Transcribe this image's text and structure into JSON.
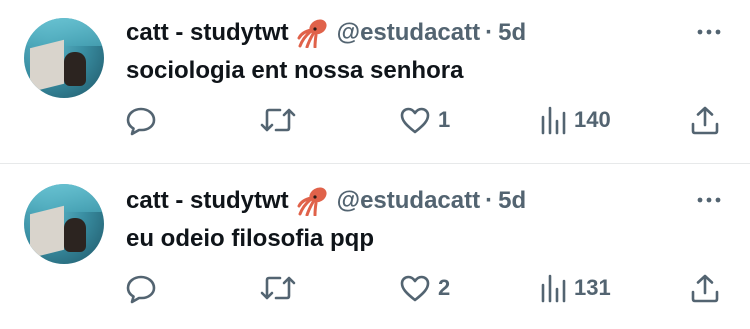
{
  "tweets": [
    {
      "author_name": "catt - studytwt",
      "author_emoji": "squid-emoji",
      "handle": "@estudacatt",
      "separator": "·",
      "time": "5d",
      "text": "sociologia ent nossa senhora",
      "likes": "1",
      "views": "140"
    },
    {
      "author_name": "catt - studytwt",
      "author_emoji": "squid-emoji",
      "handle": "@estudacatt",
      "separator": "·",
      "time": "5d",
      "text": "eu odeio filosofia pqp",
      "likes": "2",
      "views": "131"
    }
  ],
  "colors": {
    "text_primary": "#0f1419",
    "text_secondary": "#536471",
    "divider": "#e7e9ea",
    "background": "#ffffff"
  }
}
